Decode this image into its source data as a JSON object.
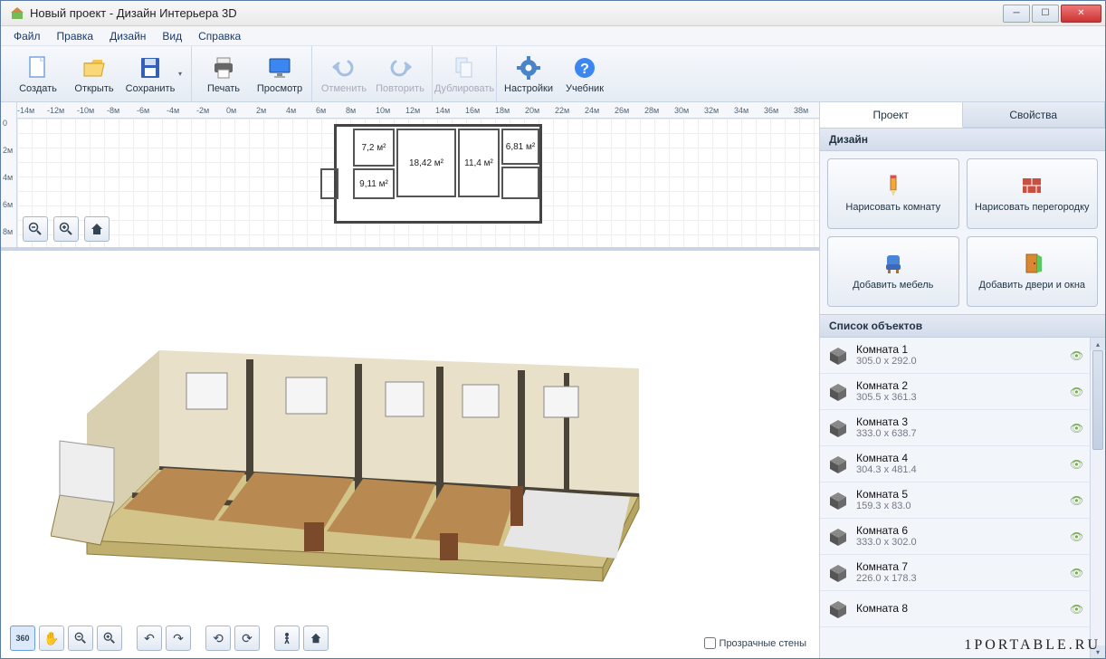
{
  "title": "Новый проект - Дизайн Интерьера 3D",
  "menu": [
    "Файл",
    "Правка",
    "Дизайн",
    "Вид",
    "Справка"
  ],
  "toolbar": {
    "create": "Создать",
    "open": "Открыть",
    "save": "Сохранить",
    "print": "Печать",
    "view": "Просмотр",
    "undo": "Отменить",
    "redo": "Повторить",
    "duplicate": "Дублировать",
    "settings": "Настройки",
    "help": "Учебник"
  },
  "ruler_h": [
    "-14м",
    "-12м",
    "-10м",
    "-8м",
    "-6м",
    "-4м",
    "-2м",
    "0м",
    "2м",
    "4м",
    "6м",
    "8м",
    "10м",
    "12м",
    "14м",
    "16м",
    "18м",
    "20м",
    "22м",
    "24м",
    "26м",
    "28м",
    "30м",
    "32м",
    "34м",
    "36м",
    "38м"
  ],
  "ruler_v": [
    "0",
    "2м",
    "4м",
    "6м",
    "8м"
  ],
  "floorplan_labels": {
    "r1": "7,2 м²",
    "r2": "18,42 м²",
    "r3": "11,4 м²",
    "r4": "6,81 м²",
    "r5": "9,11 м²"
  },
  "tabs": {
    "project": "Проект",
    "properties": "Свойства"
  },
  "design_header": "Дизайн",
  "design_buttons": {
    "draw_room": "Нарисовать комнату",
    "draw_partition": "Нарисовать перегородку",
    "add_furniture": "Добавить мебель",
    "add_doors": "Добавить двери и окна"
  },
  "objects_header": "Список объектов",
  "objects": [
    {
      "name": "Комната 1",
      "dims": "305.0 x 292.0"
    },
    {
      "name": "Комната 2",
      "dims": "305.5 x 361.3"
    },
    {
      "name": "Комната 3",
      "dims": "333.0 x 638.7"
    },
    {
      "name": "Комната 4",
      "dims": "304.3 x 481.4"
    },
    {
      "name": "Комната 5",
      "dims": "159.3 x 83.0"
    },
    {
      "name": "Комната 6",
      "dims": "333.0 x 302.0"
    },
    {
      "name": "Комната 7",
      "dims": "226.0 x 178.3"
    },
    {
      "name": "Комната 8",
      "dims": ""
    }
  ],
  "transparent_walls": "Прозрачные стены",
  "watermark": "1PORTABLE.RU"
}
